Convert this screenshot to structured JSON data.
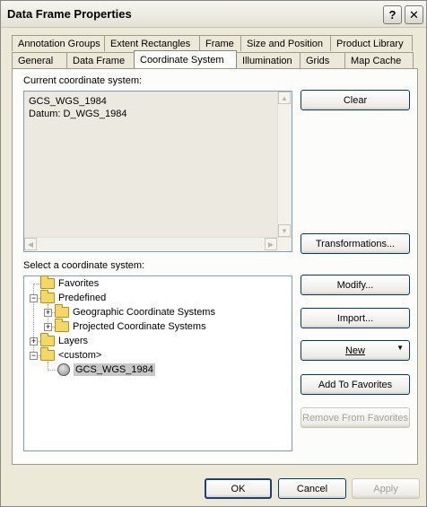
{
  "window": {
    "title": "Data Frame Properties",
    "help_glyph": "?",
    "close_glyph": "✕"
  },
  "tabs": {
    "row1": [
      "Annotation Groups",
      "Extent Rectangles",
      "Frame",
      "Size and Position",
      "Product Library"
    ],
    "row2": [
      "General",
      "Data Frame",
      "Coordinate System",
      "Illumination",
      "Grids",
      "Map Cache"
    ],
    "active": "Coordinate System"
  },
  "current": {
    "label": "Current coordinate system:",
    "lines": [
      "GCS_WGS_1984",
      "Datum: D_WGS_1984"
    ]
  },
  "select": {
    "label": "Select a coordinate system:"
  },
  "tree": {
    "favorites": "Favorites",
    "predefined": "Predefined",
    "geographic": "Geographic Coordinate Systems",
    "projected": "Projected Coordinate Systems",
    "layers": "Layers",
    "custom": "<custom>",
    "gcs": "GCS_WGS_1984"
  },
  "buttons": {
    "clear": "Clear",
    "transformations": "Transformations...",
    "modify": "Modify...",
    "import": "Import...",
    "new": "New",
    "add_fav": "Add To Favorites",
    "remove_fav": "Remove From Favorites",
    "ok": "OK",
    "cancel": "Cancel",
    "apply": "Apply"
  }
}
